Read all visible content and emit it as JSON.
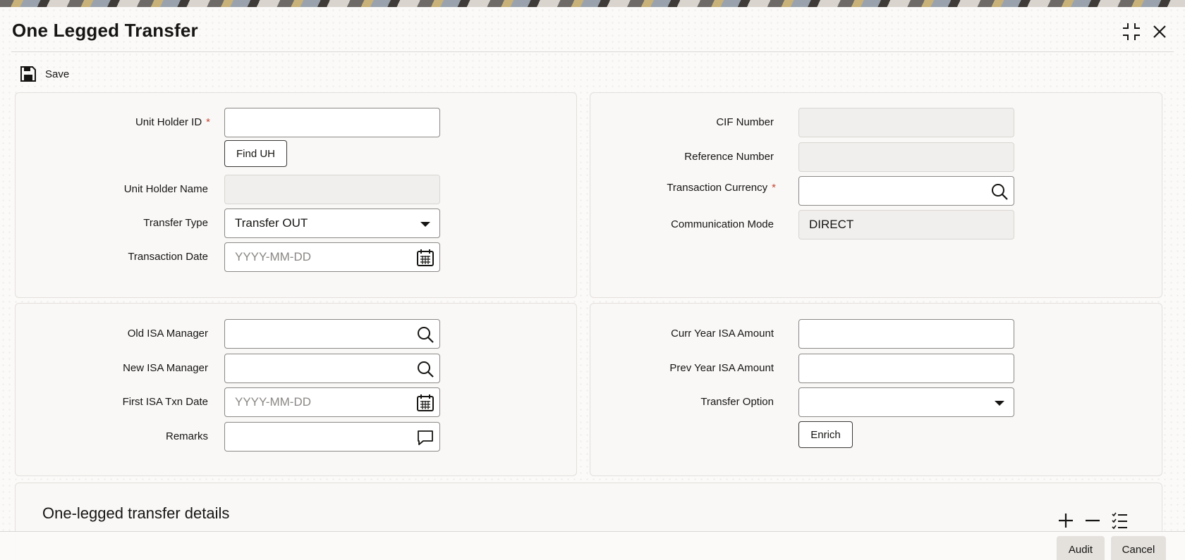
{
  "window": {
    "title": "One Legged Transfer",
    "icons": {
      "collapse": "collapse-icon",
      "close": "close-icon"
    }
  },
  "toolbar": {
    "save_label": "Save",
    "save_icon": "save-icon"
  },
  "main_panel": {
    "unit_holder_id": {
      "label": "Unit Holder ID",
      "required": "*",
      "value": ""
    },
    "find_uh_label": "Find UH",
    "unit_holder_name": {
      "label": "Unit Holder Name",
      "value": ""
    },
    "transfer_type": {
      "label": "Transfer Type",
      "value": "Transfer OUT"
    },
    "transaction_date": {
      "label": "Transaction Date",
      "placeholder": "YYYY-MM-DD"
    }
  },
  "side_panel": {
    "cif_number": {
      "label": "CIF Number",
      "value": ""
    },
    "reference_number": {
      "label": "Reference Number",
      "value": ""
    },
    "transaction_currency": {
      "label": "Transaction Currency",
      "required": "*",
      "value": ""
    },
    "communication_mode": {
      "label": "Communication Mode",
      "value": "DIRECT"
    }
  },
  "isa_panel": {
    "old_isa_manager": {
      "label": "Old ISA Manager",
      "value": ""
    },
    "new_isa_manager": {
      "label": "New ISA Manager",
      "value": ""
    },
    "first_isa_txn_date": {
      "label": "First ISA Txn Date",
      "placeholder": "YYYY-MM-DD"
    },
    "remarks": {
      "label": "Remarks",
      "value": ""
    }
  },
  "amount_panel": {
    "curr_year_isa_amount": {
      "label": "Curr Year ISA Amount",
      "value": ""
    },
    "prev_year_isa_amount": {
      "label": "Prev Year ISA Amount",
      "value": ""
    },
    "transfer_option": {
      "label": "Transfer Option",
      "value": ""
    },
    "enrich_label": "Enrich"
  },
  "details_section": {
    "title": "One-legged transfer details",
    "icons": [
      "add-row-icon",
      "remove-row-icon",
      "list-view-icon"
    ]
  },
  "footer": {
    "audit_label": "Audit",
    "cancel_label": "Cancel"
  },
  "colors": {
    "required": "#c74634",
    "border": "#8c8986",
    "readonly_bg": "#f1efed"
  }
}
